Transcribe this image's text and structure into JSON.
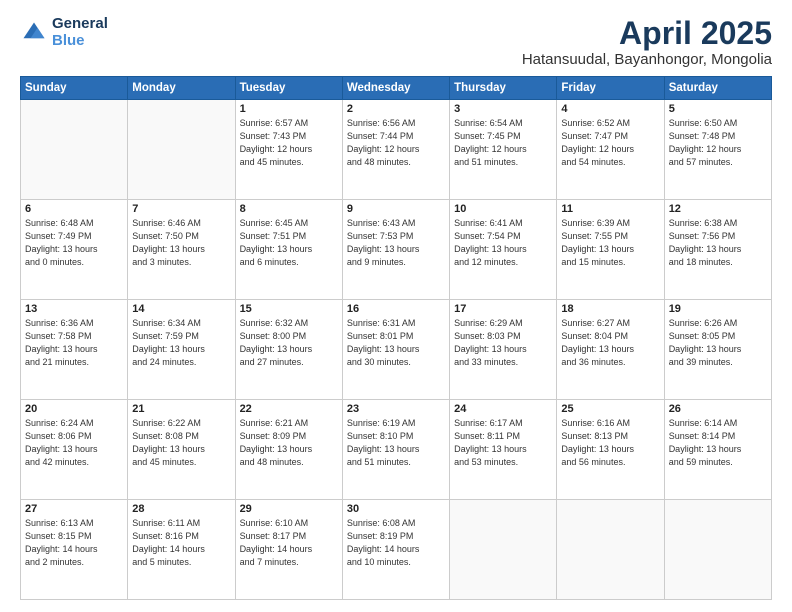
{
  "header": {
    "logo_general": "General",
    "logo_blue": "Blue",
    "title": "April 2025",
    "location": "Hatansuudal, Bayanhongor, Mongolia"
  },
  "weekdays": [
    "Sunday",
    "Monday",
    "Tuesday",
    "Wednesday",
    "Thursday",
    "Friday",
    "Saturday"
  ],
  "weeks": [
    [
      {
        "day": "",
        "info": ""
      },
      {
        "day": "",
        "info": ""
      },
      {
        "day": "1",
        "info": "Sunrise: 6:57 AM\nSunset: 7:43 PM\nDaylight: 12 hours\nand 45 minutes."
      },
      {
        "day": "2",
        "info": "Sunrise: 6:56 AM\nSunset: 7:44 PM\nDaylight: 12 hours\nand 48 minutes."
      },
      {
        "day": "3",
        "info": "Sunrise: 6:54 AM\nSunset: 7:45 PM\nDaylight: 12 hours\nand 51 minutes."
      },
      {
        "day": "4",
        "info": "Sunrise: 6:52 AM\nSunset: 7:47 PM\nDaylight: 12 hours\nand 54 minutes."
      },
      {
        "day": "5",
        "info": "Sunrise: 6:50 AM\nSunset: 7:48 PM\nDaylight: 12 hours\nand 57 minutes."
      }
    ],
    [
      {
        "day": "6",
        "info": "Sunrise: 6:48 AM\nSunset: 7:49 PM\nDaylight: 13 hours\nand 0 minutes."
      },
      {
        "day": "7",
        "info": "Sunrise: 6:46 AM\nSunset: 7:50 PM\nDaylight: 13 hours\nand 3 minutes."
      },
      {
        "day": "8",
        "info": "Sunrise: 6:45 AM\nSunset: 7:51 PM\nDaylight: 13 hours\nand 6 minutes."
      },
      {
        "day": "9",
        "info": "Sunrise: 6:43 AM\nSunset: 7:53 PM\nDaylight: 13 hours\nand 9 minutes."
      },
      {
        "day": "10",
        "info": "Sunrise: 6:41 AM\nSunset: 7:54 PM\nDaylight: 13 hours\nand 12 minutes."
      },
      {
        "day": "11",
        "info": "Sunrise: 6:39 AM\nSunset: 7:55 PM\nDaylight: 13 hours\nand 15 minutes."
      },
      {
        "day": "12",
        "info": "Sunrise: 6:38 AM\nSunset: 7:56 PM\nDaylight: 13 hours\nand 18 minutes."
      }
    ],
    [
      {
        "day": "13",
        "info": "Sunrise: 6:36 AM\nSunset: 7:58 PM\nDaylight: 13 hours\nand 21 minutes."
      },
      {
        "day": "14",
        "info": "Sunrise: 6:34 AM\nSunset: 7:59 PM\nDaylight: 13 hours\nand 24 minutes."
      },
      {
        "day": "15",
        "info": "Sunrise: 6:32 AM\nSunset: 8:00 PM\nDaylight: 13 hours\nand 27 minutes."
      },
      {
        "day": "16",
        "info": "Sunrise: 6:31 AM\nSunset: 8:01 PM\nDaylight: 13 hours\nand 30 minutes."
      },
      {
        "day": "17",
        "info": "Sunrise: 6:29 AM\nSunset: 8:03 PM\nDaylight: 13 hours\nand 33 minutes."
      },
      {
        "day": "18",
        "info": "Sunrise: 6:27 AM\nSunset: 8:04 PM\nDaylight: 13 hours\nand 36 minutes."
      },
      {
        "day": "19",
        "info": "Sunrise: 6:26 AM\nSunset: 8:05 PM\nDaylight: 13 hours\nand 39 minutes."
      }
    ],
    [
      {
        "day": "20",
        "info": "Sunrise: 6:24 AM\nSunset: 8:06 PM\nDaylight: 13 hours\nand 42 minutes."
      },
      {
        "day": "21",
        "info": "Sunrise: 6:22 AM\nSunset: 8:08 PM\nDaylight: 13 hours\nand 45 minutes."
      },
      {
        "day": "22",
        "info": "Sunrise: 6:21 AM\nSunset: 8:09 PM\nDaylight: 13 hours\nand 48 minutes."
      },
      {
        "day": "23",
        "info": "Sunrise: 6:19 AM\nSunset: 8:10 PM\nDaylight: 13 hours\nand 51 minutes."
      },
      {
        "day": "24",
        "info": "Sunrise: 6:17 AM\nSunset: 8:11 PM\nDaylight: 13 hours\nand 53 minutes."
      },
      {
        "day": "25",
        "info": "Sunrise: 6:16 AM\nSunset: 8:13 PM\nDaylight: 13 hours\nand 56 minutes."
      },
      {
        "day": "26",
        "info": "Sunrise: 6:14 AM\nSunset: 8:14 PM\nDaylight: 13 hours\nand 59 minutes."
      }
    ],
    [
      {
        "day": "27",
        "info": "Sunrise: 6:13 AM\nSunset: 8:15 PM\nDaylight: 14 hours\nand 2 minutes."
      },
      {
        "day": "28",
        "info": "Sunrise: 6:11 AM\nSunset: 8:16 PM\nDaylight: 14 hours\nand 5 minutes."
      },
      {
        "day": "29",
        "info": "Sunrise: 6:10 AM\nSunset: 8:17 PM\nDaylight: 14 hours\nand 7 minutes."
      },
      {
        "day": "30",
        "info": "Sunrise: 6:08 AM\nSunset: 8:19 PM\nDaylight: 14 hours\nand 10 minutes."
      },
      {
        "day": "",
        "info": ""
      },
      {
        "day": "",
        "info": ""
      },
      {
        "day": "",
        "info": ""
      }
    ]
  ]
}
